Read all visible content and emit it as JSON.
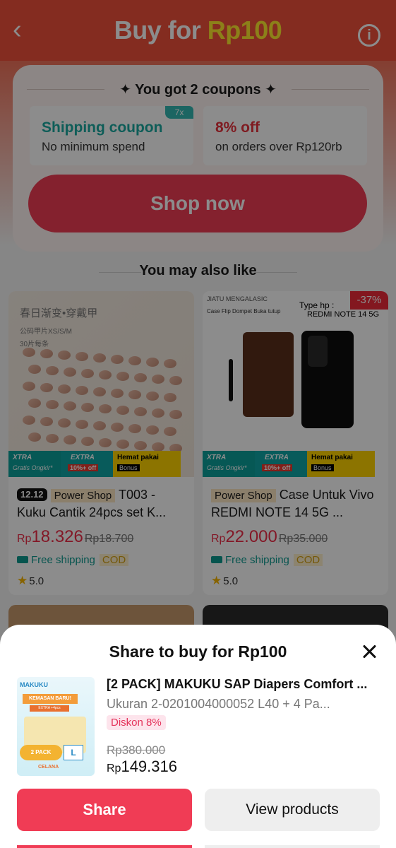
{
  "header": {
    "back_icon": "chevron-left-icon",
    "title_prefix": "Buy for ",
    "title_price": "Rp100",
    "info_icon": "info-icon",
    "colors": {
      "bar": "#f0513b",
      "price": "#ffea2e"
    }
  },
  "coupons": {
    "heading": "✦ You got 2 coupons ✦",
    "items": [
      {
        "title": "Shipping coupon",
        "subtitle": "No minimum spend",
        "multiplier": "7x"
      },
      {
        "title": "8% off",
        "subtitle": "on orders over Rp120rb"
      }
    ],
    "cta": "Shop now"
  },
  "recommendations": {
    "heading": "You may also like",
    "products": [
      {
        "image_text": [
          "春日渐变•穿戴甲",
          "公码甲片XS/S/M",
          "30片每条"
        ],
        "promo": {
          "xtra": "XTRA",
          "xtra_sub": "Gratis Ongkir*",
          "extra": "EXTRA",
          "extra_sub": "10%+ off",
          "hemat": "Hemat pakai",
          "hemat_sub": "Bonus"
        },
        "tag_event": "12.12",
        "tag_shop": "Power Shop",
        "name": "T003 - Kuku Cantik 24pcs set K...",
        "price_rp": "Rp",
        "price": "18.326",
        "old_price": "Rp18.700",
        "shipping": "Free shipping",
        "cod": "COD",
        "rating": "5.0"
      },
      {
        "image_text": [
          "JIATU MENGALASIC",
          "Case Flip Dompet Buka tutup",
          "Type hp :",
          "REDMI NOTE 14 5G"
        ],
        "discount": "-37%",
        "promo": {
          "xtra": "XTRA",
          "xtra_sub": "Gratis Ongkir*",
          "extra": "EXTRA",
          "extra_sub": "10%+ off",
          "hemat": "Hemat pakai",
          "hemat_sub": "Bonus"
        },
        "tag_shop": "Power Shop",
        "name": "Case Untuk Vivo REDMI NOTE 14 5G ...",
        "price_rp": "Rp",
        "price": "22.000",
        "old_price": "Rp35.000",
        "shipping": "Free shipping",
        "cod": "COD",
        "rating": "5.0"
      }
    ]
  },
  "share_sheet": {
    "title": "Share to buy for Rp100",
    "close_icon": "close-icon",
    "product": {
      "thumbnail_text": {
        "brand": "MAKUKU",
        "banner": "KEMASAN BARU!",
        "sub": "EXTRA +4pcs",
        "pack": "2 PACK",
        "size": "L",
        "bottom": "CELANA"
      },
      "name": "[2 PACK] MAKUKU SAP Diapers Comfort ...",
      "variant": "Ukuran 2-0201004000052 L40 + 4 Pa...",
      "discount": "Diskon 8%",
      "old_price": "Rp380.000",
      "price_rp": "Rp",
      "price": "149.316"
    },
    "buttons": {
      "share": "Share",
      "view": "View products"
    }
  }
}
